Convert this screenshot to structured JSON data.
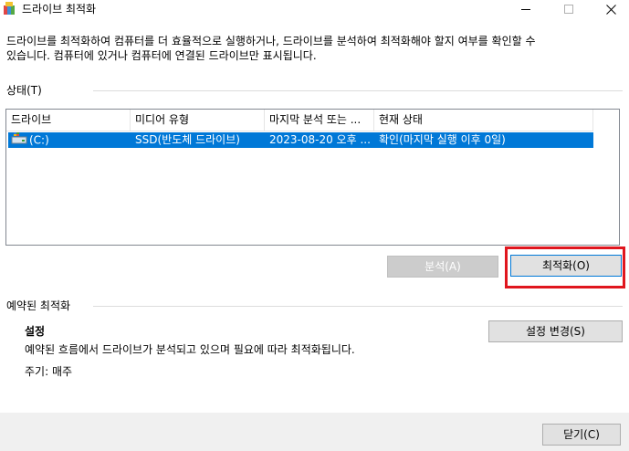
{
  "window": {
    "title": "드라이브 최적화",
    "controls": {
      "minimize": "—",
      "maximize": "☐",
      "close": "✕"
    }
  },
  "description": "드라이브를 최적화하여 컴퓨터를 더 효율적으로 실행하거나, 드라이브를 분석하여 최적화해야 할지 여부를 확인할 수\n있습니다. 컴퓨터에 있거나 컴퓨터에 연결된 드라이브만 표시됩니다.",
  "status_section": {
    "label": "상태(T)",
    "columns": [
      "드라이브",
      "미디어 유형",
      "마지막 분석 또는 ...",
      "현재 상태"
    ],
    "rows": [
      {
        "drive": "(C:)",
        "media_type": "SSD(반도체 드라이브)",
        "last_run": "2023-08-20 오후 ...",
        "status": "확인(마지막 실행 이후 0일)"
      }
    ],
    "analyze_button": "분석(A)",
    "optimize_button": "최적화(O)"
  },
  "schedule_section": {
    "label": "예약된 최적화",
    "settings_heading": "설정",
    "settings_text": "예약된 흐름에서 드라이브가 분석되고 있으며 필요에 따라 최적화됩니다.",
    "frequency": "주기: 매주",
    "change_settings_button": "설정 변경(S)"
  },
  "footer": {
    "close_button": "닫기(C)"
  },
  "colors": {
    "selection": "#0078d7",
    "highlight": "#e0161e",
    "footer_bg": "#f0f0f0"
  }
}
